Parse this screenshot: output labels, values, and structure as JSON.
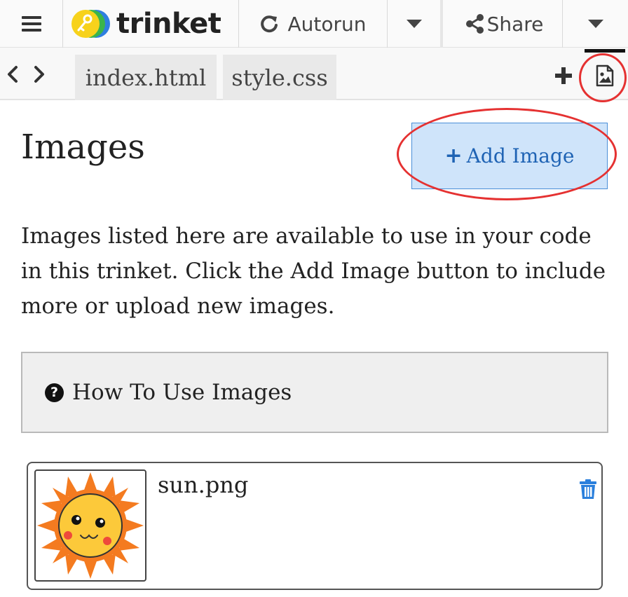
{
  "toolbar": {
    "logo_text": "trinket",
    "autorun_label": "Autorun",
    "share_label": "Share"
  },
  "tabs": [
    {
      "label": "index.html"
    },
    {
      "label": "style.css"
    }
  ],
  "images_panel": {
    "title": "Images",
    "add_image_label": "Add Image",
    "description": "Images listed here are available to use in your code in this trinket. Click the Add Image button to include more or upload new images.",
    "howto_label": "How To Use Images",
    "images": [
      {
        "filename": "sun.png"
      }
    ]
  },
  "icons": [
    "hamburger-icon",
    "refresh-icon",
    "chevron-down-icon",
    "share-icon",
    "chevron-left-icon",
    "chevron-right-icon",
    "plus-icon",
    "image-file-icon",
    "question-circle-icon",
    "trash-icon"
  ],
  "colors": {
    "accent_blue": "#1f63b4",
    "add_button_bg": "#cfe4fa",
    "annotation_red": "#e53131",
    "trash_blue": "#2a7fdc"
  }
}
